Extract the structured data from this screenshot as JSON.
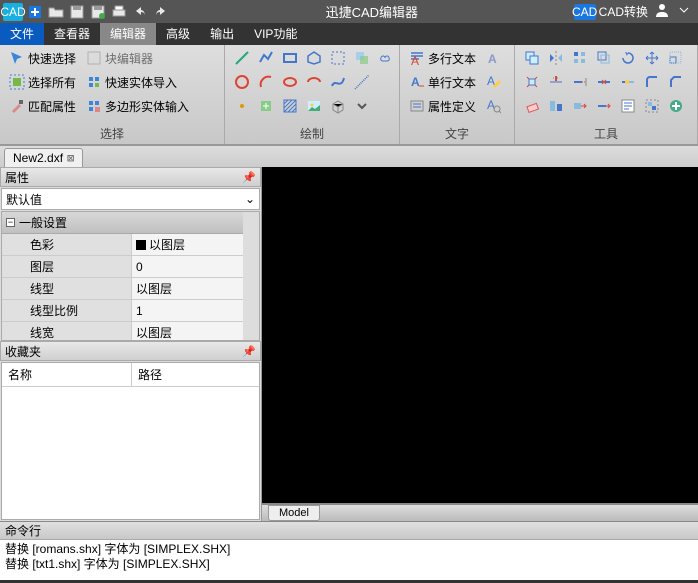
{
  "titlebar": {
    "app_abbrev": "CAD",
    "title": "迅捷CAD编辑器",
    "cad_convert": "CAD转换",
    "cad_badge": "CAD"
  },
  "menu": {
    "file": "文件",
    "viewer": "查看器",
    "editor": "编辑器",
    "advanced": "高级",
    "output": "输出",
    "vip": "VIP功能"
  },
  "ribbon": {
    "select": {
      "label": "选择",
      "quick_select": "快速选择",
      "select_all": "选择所有",
      "match_props": "匹配属性",
      "block_editor": "块编辑器",
      "fast_import": "快速实体导入",
      "poly_import": "多边形实体输入"
    },
    "draw": {
      "label": "绘制"
    },
    "text": {
      "label": "文字",
      "mtext": "多行文本",
      "stext": "单行文本",
      "attdef": "属性定义"
    },
    "tools": {
      "label": "工具"
    }
  },
  "filetab": {
    "name": "New2.dxf"
  },
  "props": {
    "panel_title": "属性",
    "combo": "默认值",
    "group": "一般设置",
    "rows": [
      {
        "k": "色彩",
        "v": "以图层",
        "swatch": true
      },
      {
        "k": "图层",
        "v": "0"
      },
      {
        "k": "线型",
        "v": "以图层"
      },
      {
        "k": "线型比例",
        "v": "1"
      },
      {
        "k": "线宽",
        "v": "以图层"
      }
    ]
  },
  "fav": {
    "panel_title": "收藏夹",
    "col_name": "名称",
    "col_path": "路径"
  },
  "model_tab": "Model",
  "cmd": {
    "title": "命令行",
    "line1": "替换 [romans.shx] 字体为 [SIMPLEX.SHX]",
    "line2": "替换 [txt1.shx] 字体为 [SIMPLEX.SHX]"
  }
}
